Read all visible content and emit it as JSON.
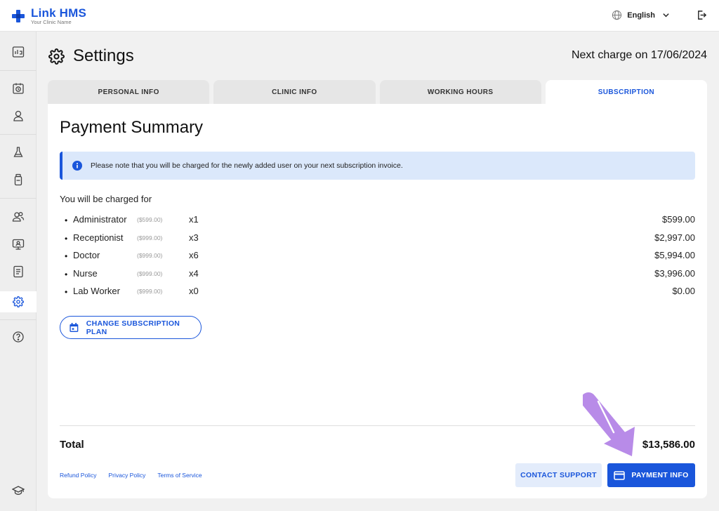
{
  "app": {
    "name": "Link HMS",
    "subtitle": "Your Clinic Name",
    "brand_color": "#1a56db"
  },
  "topbar": {
    "language": "English",
    "language_icon": "globe-icon",
    "logout_icon": "logout-icon"
  },
  "sidebar": {
    "items": [
      {
        "name": "dashboard",
        "icon": "chart-icon"
      },
      {
        "name": "appointments",
        "icon": "calendar-clock-icon"
      },
      {
        "name": "patients",
        "icon": "person-icon"
      },
      {
        "name": "lab",
        "icon": "flask-icon"
      },
      {
        "name": "pharmacy",
        "icon": "bottle-icon"
      },
      {
        "name": "staff",
        "icon": "users-icon"
      },
      {
        "name": "monitor",
        "icon": "monitor-icon"
      },
      {
        "name": "reports",
        "icon": "document-icon"
      },
      {
        "name": "settings",
        "icon": "gear-icon",
        "active": true
      },
      {
        "name": "help",
        "icon": "help-icon"
      },
      {
        "name": "education",
        "icon": "graduation-cap-icon"
      }
    ]
  },
  "header": {
    "title": "Settings",
    "next_charge": "Next charge on 17/06/2024"
  },
  "tabs": [
    {
      "label": "PERSONAL INFO",
      "active": false
    },
    {
      "label": "CLINIC INFO",
      "active": false
    },
    {
      "label": "WORKING HOURS",
      "active": false
    },
    {
      "label": "SUBSCRIPTION",
      "active": true
    }
  ],
  "summary": {
    "title": "Payment Summary",
    "alert": "Please note that you will be charged for the newly added user on your next subscription invoice.",
    "charged_for": "You will be charged for",
    "lines": [
      {
        "role": "Administrator",
        "unit_price": "($599.00)",
        "qty": "x1",
        "amount": "$599.00"
      },
      {
        "role": "Receptionist",
        "unit_price": "($999.00)",
        "qty": "x3",
        "amount": "$2,997.00"
      },
      {
        "role": "Doctor",
        "unit_price": "($999.00)",
        "qty": "x6",
        "amount": "$5,994.00"
      },
      {
        "role": "Nurse",
        "unit_price": "($999.00)",
        "qty": "x4",
        "amount": "$3,996.00"
      },
      {
        "role": "Lab Worker",
        "unit_price": "($999.00)",
        "qty": "x0",
        "amount": "$0.00"
      }
    ],
    "change_plan_label": "CHANGE SUBSCRIPTION PLAN",
    "total_label": "Total",
    "total_value": "$13,586.00"
  },
  "footer": {
    "links": [
      "Refund Policy",
      "Privacy Policy",
      "Terms of Service"
    ],
    "contact_label": "CONTACT SUPPORT",
    "payment_label": "PAYMENT INFO"
  },
  "annotation": {
    "arrow_color": "#b88be8"
  }
}
